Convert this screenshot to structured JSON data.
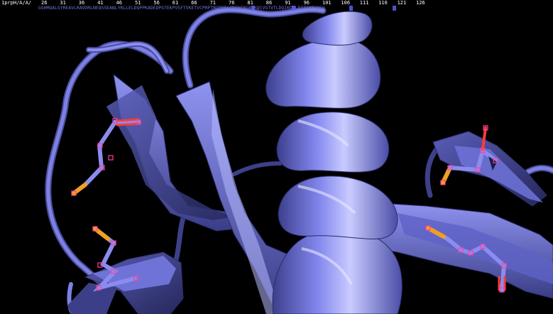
{
  "sequence_viewer": {
    "object_name": "1prpH/A/A/",
    "ruler": [
      "26",
      "31",
      "36",
      "41",
      "46",
      "51",
      "56",
      "61",
      "66",
      "71",
      "76",
      "81",
      "86",
      "91",
      "96",
      "101",
      "106",
      "111",
      "116",
      "121",
      "126"
    ],
    "residues": "GSHMQALSYREAVLRAVDRLNEQSSEANLYRLLELDQPPKADEDPGTEKPVSFTVKETVCPRPTRQPPELCDFKENGRVKQCVGTVTLDQIKDPLDITCNEVQGV"
  },
  "colors": {
    "background": "#000000",
    "cartoon": "#7b7fe6",
    "carbon": "#8a8cef",
    "oxygen": "#ff3b3b",
    "sulfur": "#f0a020",
    "sequence_text": "#6f73d8",
    "selection": "#ff40a0"
  },
  "scene": {
    "representation": "cartoon",
    "structure_elements": [
      "alpha-helix",
      "beta-strands",
      "loops"
    ],
    "stick_sidechains": 3
  }
}
